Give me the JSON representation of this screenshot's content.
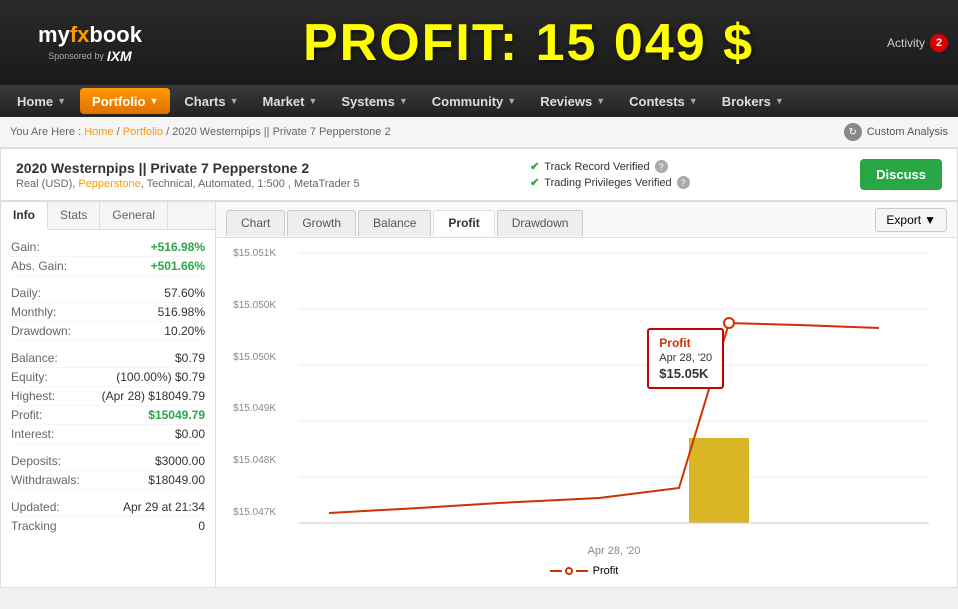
{
  "topBar": {
    "logoText": "my",
    "logoFx": "fx",
    "logoBook": "book",
    "sponsoredBy": "Sponsored by",
    "ixm": "IXM",
    "profitBanner": "PROFIT: 15 049 $",
    "activityLabel": "Activity",
    "activityCount": "2"
  },
  "nav": {
    "items": [
      {
        "label": "Home",
        "hasArrow": true,
        "active": false
      },
      {
        "label": "Portfolio",
        "hasArrow": true,
        "active": true
      },
      {
        "label": "Charts",
        "hasArrow": true,
        "active": false
      },
      {
        "label": "Market",
        "hasArrow": true,
        "active": false
      },
      {
        "label": "Systems",
        "hasArrow": true,
        "active": false
      },
      {
        "label": "Community",
        "hasArrow": true,
        "active": false
      },
      {
        "label": "Reviews",
        "hasArrow": true,
        "active": false
      },
      {
        "label": "Contests",
        "hasArrow": true,
        "active": false
      },
      {
        "label": "Brokers",
        "hasArrow": true,
        "active": false
      }
    ]
  },
  "breadcrumb": {
    "prefix": "You Are Here :",
    "home": "Home",
    "portfolio": "Portfolio",
    "current": "2020 Westernpips || Private 7 Pepperstone 2"
  },
  "customAnalysis": {
    "label": "Custom Analysis"
  },
  "account": {
    "title": "2020 Westernpips || Private 7 Pepperstone 2",
    "subtitle": "Real (USD), Pepperstone, Technical, Automated, 1:500 , MetaTrader 5",
    "verified1": "Track Record Verified",
    "verified2": "Trading Privileges Verified",
    "discussBtn": "Discuss"
  },
  "leftPanel": {
    "tabs": [
      {
        "label": "Info",
        "active": true
      },
      {
        "label": "Stats",
        "active": false
      },
      {
        "label": "General",
        "active": false
      }
    ],
    "stats": [
      {
        "label": "Gain:",
        "value": "+516.98%",
        "green": true
      },
      {
        "label": "Abs. Gain:",
        "value": "+501.66%",
        "green": true
      },
      {
        "label": "",
        "value": "",
        "spacer": true
      },
      {
        "label": "Daily:",
        "value": "57.60%",
        "green": false
      },
      {
        "label": "Monthly:",
        "value": "516.98%",
        "green": false
      },
      {
        "label": "Drawdown:",
        "value": "10.20%",
        "green": false
      },
      {
        "label": "",
        "value": "",
        "spacer": true
      },
      {
        "label": "Balance:",
        "value": "$0.79",
        "green": false
      },
      {
        "label": "Equity:",
        "value": "(100.00%) $0.79",
        "green": false
      },
      {
        "label": "Highest:",
        "value": "(Apr 28) $18049.79",
        "green": false
      },
      {
        "label": "Profit:",
        "value": "$15049.79",
        "green": true,
        "profit": true
      },
      {
        "label": "Interest:",
        "value": "$0.00",
        "green": false
      },
      {
        "label": "",
        "value": "",
        "spacer": true
      },
      {
        "label": "Deposits:",
        "value": "$3000.00",
        "green": false
      },
      {
        "label": "Withdrawals:",
        "value": "$18049.00",
        "green": false
      },
      {
        "label": "",
        "value": "",
        "spacer": true
      },
      {
        "label": "Updated:",
        "value": "Apr 29 at 21:34",
        "green": false
      },
      {
        "label": "Tracking",
        "value": "0",
        "green": false
      }
    ]
  },
  "chartPanel": {
    "tabs": [
      {
        "label": "Chart",
        "active": false
      },
      {
        "label": "Growth",
        "active": false
      },
      {
        "label": "Balance",
        "active": false
      },
      {
        "label": "Profit",
        "active": true
      },
      {
        "label": "Drawdown",
        "active": false
      }
    ],
    "exportBtn": "Export",
    "yLabels": [
      "$15.051K",
      "$15.050K",
      "$15.050K",
      "$15.049K",
      "$15.048K",
      "$15.047K"
    ],
    "xLabel": "Apr 28, '20",
    "tooltip": {
      "title": "Profit",
      "date": "Apr 28, '20",
      "value": "$15.05K"
    },
    "legend": {
      "label": "Profit"
    }
  }
}
